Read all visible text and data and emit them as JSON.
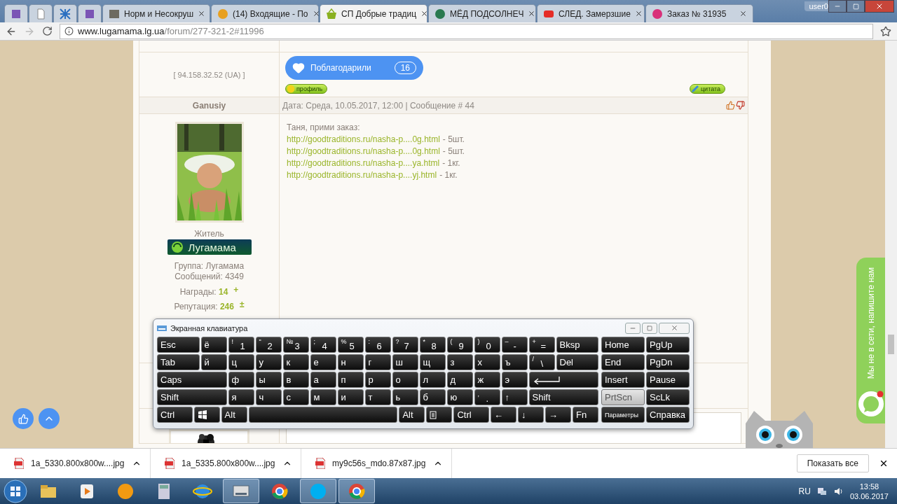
{
  "browser": {
    "tabs": [
      {
        "selected": false
      },
      {
        "selected": false
      },
      {
        "selected": false
      },
      {
        "selected": false
      },
      {
        "title": "Норм и Несокруш",
        "selected": false
      },
      {
        "title": "(14) Входящие - По",
        "selected": false
      },
      {
        "title": "СП Добрые традиц",
        "selected": true
      },
      {
        "title": "МЁД ПОДСОЛНЕЧ",
        "selected": false
      },
      {
        "title": "СЛЕД. Замерзшие",
        "selected": false
      },
      {
        "title": "Заказ № 31935",
        "selected": false
      }
    ],
    "user": "user0",
    "address": {
      "host": "www.lugamama.lg.ua",
      "path": "/forum/277-321-2#11996"
    }
  },
  "forum": {
    "prev_post": {
      "ip": "[ 94.158.32.52 (UA) ]",
      "thanks": {
        "label": "Поблагодарили",
        "count": "16"
      },
      "profile_button": "профиль",
      "quote_button": "цитата"
    },
    "post": {
      "author": "Ganusiy",
      "meta": "Дата: Среда, 10.05.2017, 12:00 | Сообщение # 44",
      "rank": "Житель",
      "badge": "Лугамама",
      "group": "Группа: Лугамама",
      "messages": "Сообщений: 4349",
      "awards_label": "Награды:",
      "awards": "14",
      "awards_action": "+",
      "reputation_label": "Репутация:",
      "reputation": "246",
      "reputation_action": "±",
      "greeting": "Таня, прими заказ:",
      "lines": [
        {
          "link": "http://goodtraditions.ru/nasha-p....0g.html",
          "note": "- 5шт."
        },
        {
          "link": "http://goodtraditions.ru/nasha-p....0g.html",
          "note": "- 5шт."
        },
        {
          "link": "http://goodtraditions.ru/nasha-p....ya.html",
          "note": "- 1кг."
        },
        {
          "link": "http://goodtraditions.ru/nasha-p....yj.html",
          "note": "- 1кг."
        }
      ]
    }
  },
  "chat": {
    "label": "Мы не в сети, напишите нам"
  },
  "keyboard": {
    "title": "Экранная клавиатура",
    "rows": [
      {
        "keys": [
          {
            "label": "Esc",
            "kind": "wide"
          },
          {
            "label": "ё",
            "kind": "char"
          },
          {
            "label": "1",
            "shift": "!",
            "kind": "char"
          },
          {
            "label": "2",
            "shift": "\"",
            "kind": "char"
          },
          {
            "label": "3",
            "shift": "№",
            "kind": "char"
          },
          {
            "label": "4",
            "shift": ";",
            "kind": "char"
          },
          {
            "label": "5",
            "shift": "%",
            "kind": "char"
          },
          {
            "label": "6",
            "shift": ":",
            "kind": "char"
          },
          {
            "label": "7",
            "shift": "?",
            "kind": "char"
          },
          {
            "label": "8",
            "shift": "*",
            "kind": "char"
          },
          {
            "label": "9",
            "shift": "(",
            "kind": "char"
          },
          {
            "label": "0",
            "shift": ")",
            "kind": "char"
          },
          {
            "label": "-",
            "shift": "–",
            "kind": "char"
          },
          {
            "label": "=",
            "shift": "+",
            "kind": "char"
          },
          {
            "label": "Bksp",
            "kind": "wide"
          }
        ]
      },
      {
        "keys": [
          {
            "label": "Tab",
            "kind": "wide"
          },
          {
            "label": "й",
            "kind": "char"
          },
          {
            "label": "ц",
            "kind": "char"
          },
          {
            "label": "у",
            "kind": "char"
          },
          {
            "label": "к",
            "kind": "char"
          },
          {
            "label": "е",
            "kind": "char"
          },
          {
            "label": "н",
            "kind": "char"
          },
          {
            "label": "г",
            "kind": "char"
          },
          {
            "label": "ш",
            "kind": "char"
          },
          {
            "label": "щ",
            "kind": "char"
          },
          {
            "label": "з",
            "kind": "char"
          },
          {
            "label": "х",
            "kind": "char"
          },
          {
            "label": "ъ",
            "kind": "char"
          },
          {
            "label": "\\",
            "shift": "/",
            "kind": "char"
          },
          {
            "label": "Del",
            "kind": "wide"
          }
        ]
      },
      {
        "keys": [
          {
            "label": "Caps",
            "kind": "wide"
          },
          {
            "label": "ф",
            "kind": "char"
          },
          {
            "label": "ы",
            "kind": "char"
          },
          {
            "label": "в",
            "kind": "char"
          },
          {
            "label": "а",
            "kind": "char"
          },
          {
            "label": "п",
            "kind": "char"
          },
          {
            "label": "р",
            "kind": "char"
          },
          {
            "label": "о",
            "kind": "char"
          },
          {
            "label": "л",
            "kind": "char"
          },
          {
            "label": "д",
            "kind": "char"
          },
          {
            "label": "ж",
            "kind": "char"
          },
          {
            "label": "э",
            "kind": "char"
          },
          {
            "kind": "enter"
          }
        ]
      },
      {
        "keys": [
          {
            "label": "Shift",
            "kind": "wide"
          },
          {
            "label": "я",
            "kind": "char"
          },
          {
            "label": "ч",
            "kind": "char"
          },
          {
            "label": "с",
            "kind": "char"
          },
          {
            "label": "м",
            "kind": "char"
          },
          {
            "label": "и",
            "kind": "char"
          },
          {
            "label": "т",
            "kind": "char"
          },
          {
            "label": "ь",
            "kind": "char"
          },
          {
            "label": "б",
            "kind": "char"
          },
          {
            "label": "ю",
            "kind": "char"
          },
          {
            "label": ".",
            "shift": ",",
            "kind": "char"
          },
          {
            "label": "↑",
            "kind": "char"
          },
          {
            "label": "Shift",
            "kind": "wide"
          }
        ]
      },
      {
        "keys": [
          {
            "label": "Ctrl",
            "kind": "wide"
          },
          {
            "kind": "win"
          },
          {
            "label": "Alt",
            "kind": "char"
          },
          {
            "kind": "space"
          },
          {
            "label": "Alt",
            "kind": "char"
          },
          {
            "kind": "menu"
          },
          {
            "label": "Ctrl",
            "kind": "wide"
          },
          {
            "label": "←",
            "kind": "char"
          },
          {
            "label": "↓",
            "kind": "char"
          },
          {
            "label": "→",
            "kind": "char"
          },
          {
            "label": "Fn",
            "kind": "char"
          }
        ]
      }
    ],
    "side_rows": [
      [
        {
          "label": "Home",
          "pressed": false
        },
        {
          "label": "PgUp",
          "pressed": false
        }
      ],
      [
        {
          "label": "End",
          "pressed": false
        },
        {
          "label": "PgDn",
          "pressed": false
        }
      ],
      [
        {
          "label": "Insert",
          "pressed": false
        },
        {
          "label": "Pause",
          "pressed": false
        }
      ],
      [
        {
          "label": "PrtScn",
          "pressed": true
        },
        {
          "label": "ScLk",
          "pressed": false
        }
      ],
      [
        {
          "label": "Параметры",
          "pressed": false
        },
        {
          "label": "Справка",
          "pressed": false
        }
      ]
    ]
  },
  "downloads": {
    "items": [
      {
        "name": "1a_5330.800x800w....jpg"
      },
      {
        "name": "1a_5335.800x800w....jpg"
      },
      {
        "name": "my9c56s_mdo.87x87.jpg"
      }
    ],
    "show_all": "Показать все"
  },
  "taskbar": {
    "apps": [
      {
        "selected": false
      },
      {
        "selected": false
      },
      {
        "selected": false
      },
      {
        "selected": false
      },
      {
        "selected": false
      },
      {
        "selected": true
      },
      {
        "selected": false
      },
      {
        "selected": true
      },
      {
        "selected": true
      }
    ],
    "language": "RU",
    "time": "13:58",
    "date": "03.06.2017"
  }
}
